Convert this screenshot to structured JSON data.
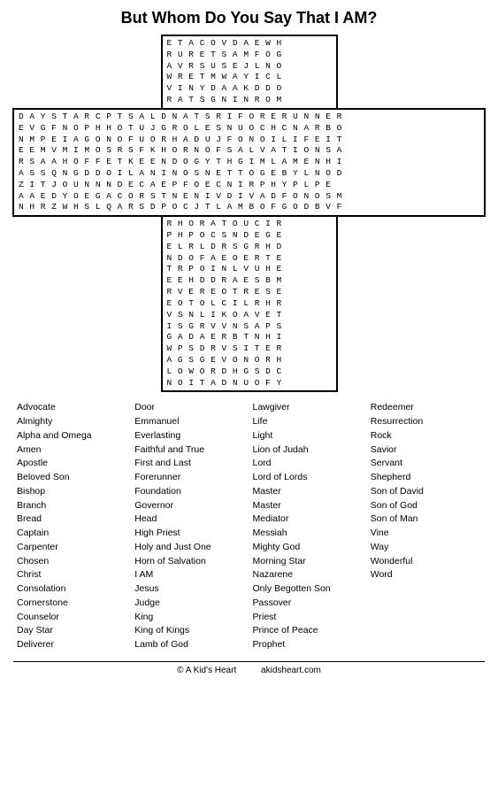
{
  "title": "But Whom Do You Say That I AM?",
  "puzzle": {
    "top_rows": [
      "E T A C O V D A E W H",
      "R U R E T S A M F O G",
      "A V R S U S E J L N O",
      "W R E T M W A Y I C L",
      "V I N Y D A A K D D O",
      "R A T S G N I N R O M"
    ],
    "mid_rows": [
      "D A Y S T A R C P T S A L D N A T S R I F O R E R U N N E R",
      "E V G F N O P H H O T U J G R O L E S N U O C H C N A R B O",
      "N M P E I A G O N O F U O R H A D U J F O N O I L I F E I T",
      "E E M V M I M O S R S F K H O R N O F S A L V A T I O N S A",
      "R S A A H O F F E T K E E N D O G Y T H G I M L A M E N H I",
      "A S S Q N G D D O I L A N I N O S N E T T O G E B Y L N O D",
      "Z I T J O U N N N D E C A E P F O E C N I R P H Y P L P E",
      "A A E D Y O E G A C O R S T N E N I V D I V A D F O N O S M",
      "N H R Z W H S L Q A R S D P O C J T L A M B O F G O D B V F"
    ],
    "bot_rows": [
      "R H O R A T O U C I R",
      "P H P O C S N D E G E",
      "E L R L D R S G R H D",
      "N D O F A E O E R T E",
      "T R P O I N L V U H E",
      "E E H D D R A E S B M",
      "R V E R E O T R E S E",
      "E O T O L C I L R H R",
      "V S N L I K O A V E T",
      "I S G R V V N S A P S",
      "G A D A E R B T N H I",
      "W P S D R V S I T E R",
      "A G S G E V O N O R H",
      "L O W O R D H G S D C",
      "N O I T A D N U O F Y"
    ]
  },
  "word_list": {
    "col1": [
      "Advocate",
      "Almighty",
      "Alpha and Omega",
      "Amen",
      "Apostle",
      "Beloved Son",
      "Bishop",
      "Branch",
      "Bread",
      "Captain",
      "Carpenter",
      "Chosen",
      "Christ",
      "Consolation",
      "Cornerstone",
      "Counselor",
      "Day Star",
      "Deliverer"
    ],
    "col2": [
      "Door",
      "Emmanuel",
      "Everlasting",
      "Faithful and True",
      "First and Last",
      "Forerunner",
      "Foundation",
      "Governor",
      "Head",
      "High Priest",
      "Holy and Just One",
      "Horn of Salvation",
      "I AM",
      "Jesus",
      "Judge",
      "King",
      "King of Kings",
      "Lamb of God"
    ],
    "col3": [
      "Lawgiver",
      "Life",
      "Light",
      "Lion of Judah",
      "Lord",
      "Lord of Lords",
      "Master",
      "Master",
      "Mediator",
      "Messiah",
      "Mighty God",
      "Morning Star",
      "Nazarene",
      "Only Begotten Son",
      "Passover",
      "Priest",
      "Prince of Peace",
      "Prophet"
    ],
    "col4": [
      "Redeemer",
      "Resurrection",
      "Rock",
      "Savior",
      "Servant",
      "Shepherd",
      "Son of David",
      "Son of God",
      "Son of Man",
      "Vine",
      "Way",
      "Wonderful",
      "Word"
    ]
  },
  "footer": {
    "left": "© A Kid's Heart",
    "right": "akidsheart.com"
  }
}
